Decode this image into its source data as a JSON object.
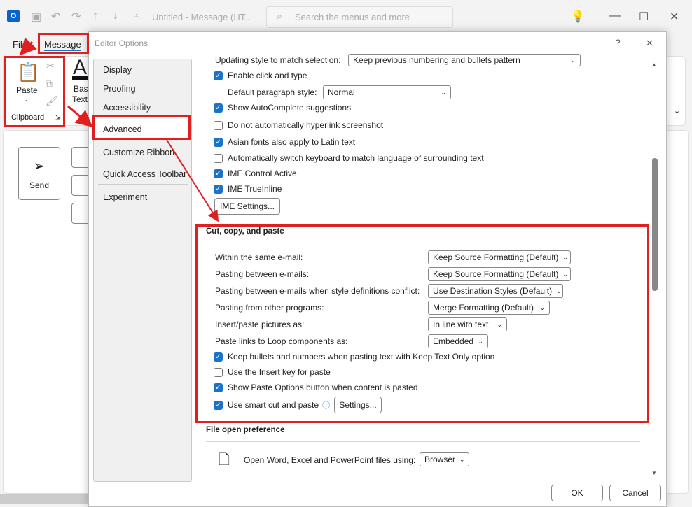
{
  "titlebar": {
    "title": "Untitled  -  Message (HT...",
    "search_placeholder": "Search the menus and more"
  },
  "ribbon": {
    "tabs": [
      "File",
      "Message"
    ],
    "paste": "Paste",
    "clipboard": "Clipboard",
    "basic_text": [
      "Basi",
      "Text"
    ],
    "send": "Send"
  },
  "dialog": {
    "title": "Editor Options",
    "help": "?",
    "close": "✕",
    "nav": [
      "Display",
      "Proofing",
      "Accessibility",
      "Advanced",
      "Customize Ribbon",
      "Quick Access Toolbar",
      "Experiment"
    ],
    "top": {
      "updating_label": "Updating style to match selection:",
      "updating_value": "Keep previous numbering and bullets pattern",
      "enable_click": "Enable click and type",
      "default_para_label": "Default paragraph style:",
      "default_para_value": "Normal",
      "autocomplete": "Show AutoComplete suggestions",
      "hyperlink": "Do not automatically hyperlink screenshot",
      "asian_fonts": "Asian fonts also apply to Latin text",
      "switch_kb": "Automatically switch keyboard to match language of surrounding text",
      "ime_control": "IME Control Active",
      "ime_trueinline": "IME TrueInline",
      "ime_settings": "IME Settings..."
    },
    "cut": {
      "header": "Cut, copy, and paste",
      "rows": [
        {
          "label": "Within the same e-mail:",
          "value": "Keep Source Formatting (Default)"
        },
        {
          "label": "Pasting between e-mails:",
          "value": "Keep Source Formatting (Default)"
        },
        {
          "label": "Pasting between e-mails when style definitions conflict:",
          "value": "Use Destination Styles (Default)"
        },
        {
          "label": "Pasting from other programs:",
          "value": "Merge Formatting (Default)"
        },
        {
          "label": "Insert/paste pictures as:",
          "value": "In line with text"
        },
        {
          "label": "Paste links to Loop components as:",
          "value": "Embedded"
        }
      ],
      "keep_bullets": "Keep bullets and numbers when pasting text with Keep Text Only option",
      "insert_key": "Use the Insert key for paste",
      "paste_options": "Show Paste Options button when content is pasted",
      "smart_cut": "Use smart cut and paste",
      "settings": "Settings..."
    },
    "file_open": {
      "header": "File open preference",
      "label": "Open Word, Excel and PowerPoint files using:",
      "value": "Browser"
    },
    "ok": "OK",
    "cancel": "Cancel"
  },
  "colors": {
    "accent": "#1a73c8",
    "highlight": "#e02020"
  }
}
